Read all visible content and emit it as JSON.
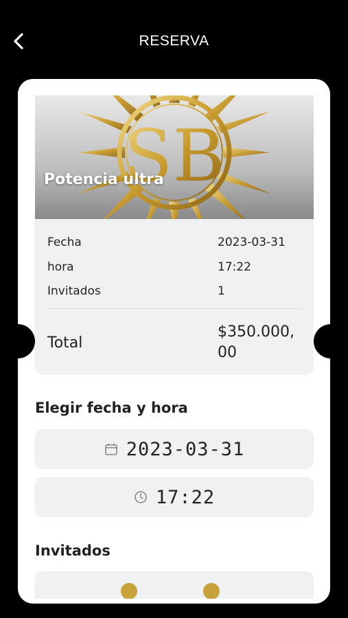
{
  "header": {
    "title": "RESERVA",
    "back_icon": "chevron-left-icon"
  },
  "banner": {
    "title": "Potencia ultra",
    "logo_text": "SB"
  },
  "summary": {
    "rows": [
      {
        "label": "Fecha",
        "value": "2023-03-31"
      },
      {
        "label": "hora",
        "value": "17:22"
      },
      {
        "label": "Invitados",
        "value": "1"
      }
    ],
    "total_label": "Total",
    "total_value": "$350.000,00"
  },
  "date_section": {
    "title": "Elegir fecha y hora",
    "date_value": "2023-03-31",
    "time_value": "17:22",
    "date_icon": "calendar-icon",
    "time_icon": "clock-icon"
  },
  "guests_section": {
    "title": "Invitados"
  },
  "colors": {
    "background": "#000000",
    "card": "#ffffff",
    "panel": "#f0f1f3",
    "gold": "#c8a23a"
  }
}
